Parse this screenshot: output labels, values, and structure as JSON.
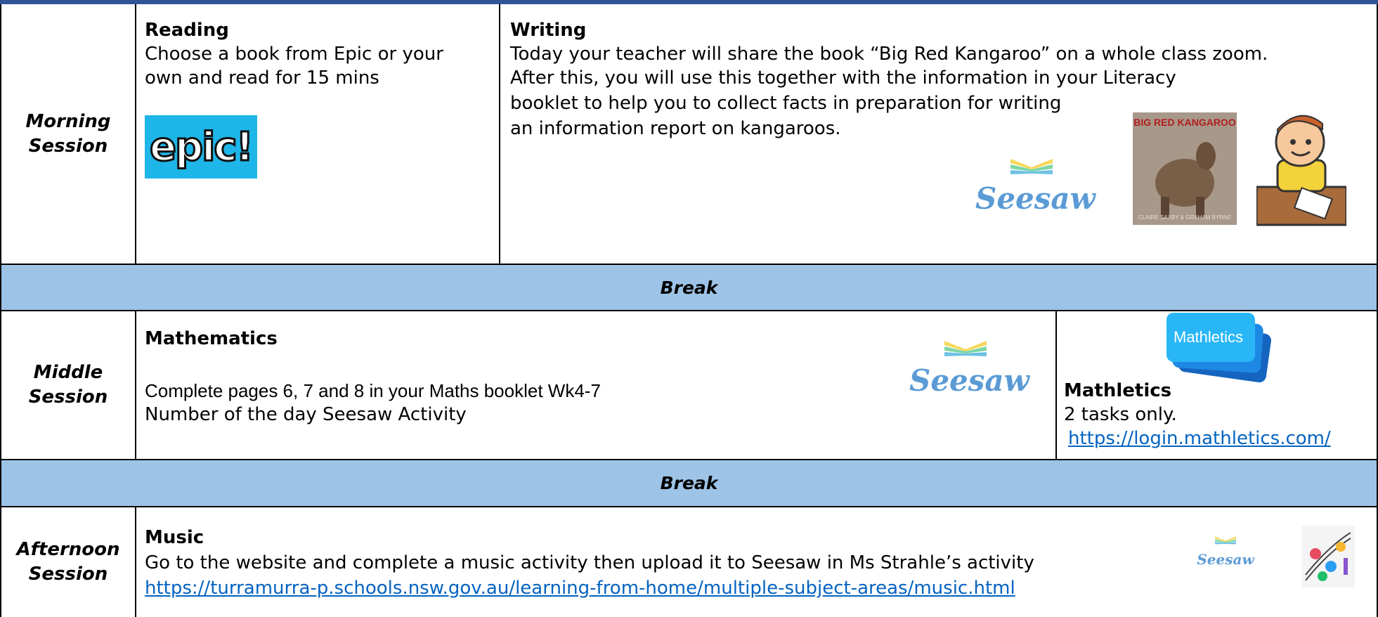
{
  "sessions": {
    "morning": {
      "label_line1": "Morning",
      "label_line2": "Session"
    },
    "middle": {
      "label_line1": "Middle",
      "label_line2": "Session"
    },
    "afternoon": {
      "label_line1": "Afternoon",
      "label_line2": "Session"
    }
  },
  "reading": {
    "title": "Reading",
    "line1": "Choose a book from Epic or your",
    "line2": "own and read for 15 mins",
    "logo_text": "epic!"
  },
  "writing": {
    "title": "Writing",
    "line1": "Today your teacher will share the book “Big Red Kangaroo” on a whole class zoom.",
    "line2": "After this, you will use this together with the information in your Literacy",
    "line3": "booklet to help you to collect facts in preparation for writing",
    "line4": "an information report on kangaroos.",
    "seesaw_text": "Seesaw",
    "book_title": "BIG RED KANGAROO",
    "book_authors": "CLAIRE SAXBY & GRAHAM BYRNE"
  },
  "break_label": "Break",
  "mathematics": {
    "title": "Mathematics",
    "line1": "Complete pages 6, 7 and 8 in your Maths booklet Wk4-7",
    "line2": "Number of the day Seesaw Activity",
    "seesaw_text": "Seesaw"
  },
  "mathletics": {
    "logo_text": "Mathletics",
    "title": "Mathletics",
    "line1": "2 tasks only.",
    "link": "https://login.mathletics.com/"
  },
  "music": {
    "title": "Music",
    "line1": "Go to the website and complete a music activity then upload it to Seesaw in Ms Strahle’s activity",
    "link": "https://turramurra-p.schools.nsw.gov.au/learning-from-home/multiple-subject-areas/music.html",
    "seesaw_text": "Seesaw"
  },
  "colors": {
    "break_bg": "#9dc3e6",
    "link": "#0563c1",
    "header_bar": "#2f5597",
    "seesaw_blue": "#5b9bd5"
  }
}
